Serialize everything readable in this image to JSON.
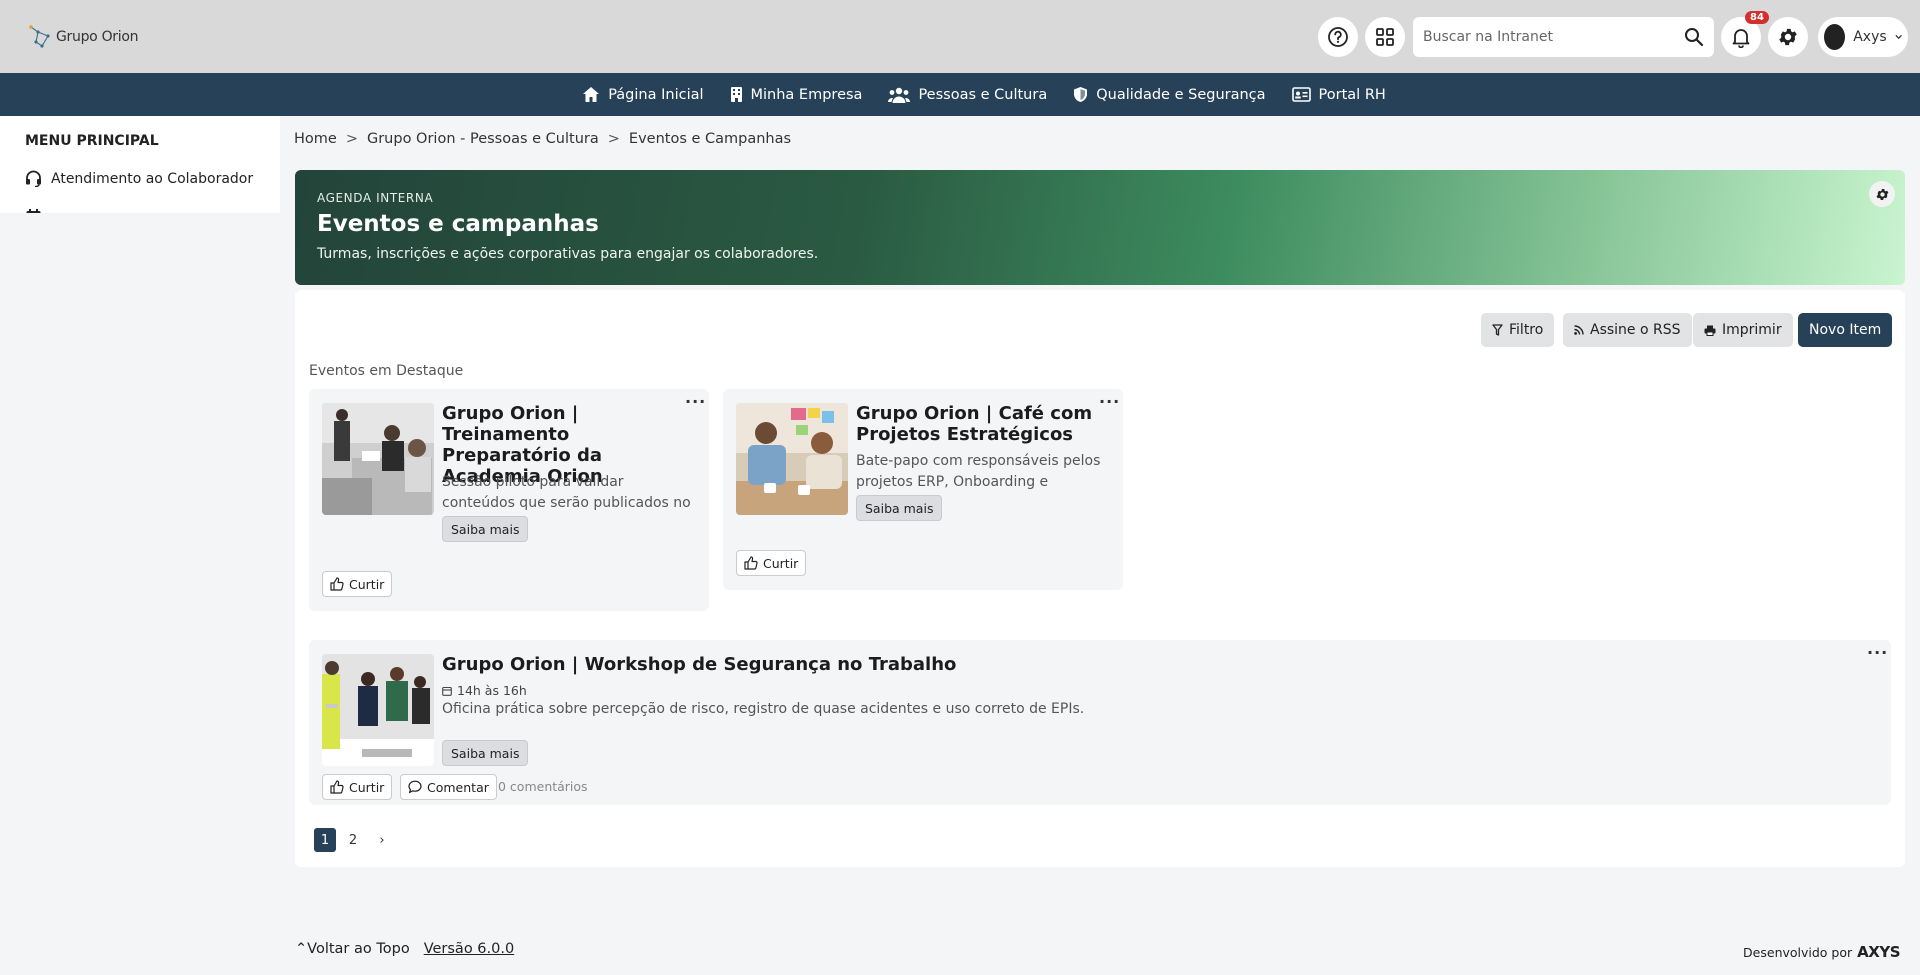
{
  "header": {
    "logo_text": "Grupo Orion",
    "search_placeholder": "Buscar na Intranet",
    "notifications_count": "84",
    "user_name": "Axys"
  },
  "nav": {
    "items": [
      {
        "label": "Página Inicial",
        "icon": "home-icon"
      },
      {
        "label": "Minha Empresa",
        "icon": "building-icon"
      },
      {
        "label": "Pessoas e Cultura",
        "icon": "people-icon"
      },
      {
        "label": "Qualidade e Segurança",
        "icon": "shield-icon"
      },
      {
        "label": "Portal RH",
        "icon": "id-card-icon"
      }
    ]
  },
  "sidebar": {
    "title": "MENU PRINCIPAL",
    "items": [
      {
        "label": "Atendimento ao Colaborador",
        "icon": "headset-icon"
      }
    ]
  },
  "breadcrumb": [
    "Home",
    "Grupo Orion - Pessoas e Cultura",
    "Eventos e Campanhas"
  ],
  "hero": {
    "kicker": "AGENDA INTERNA",
    "title": "Eventos e campanhas",
    "subtitle": "Turmas, inscrições e ações corporativas para engajar os colaboradores."
  },
  "toolbar": {
    "filter": "Filtro",
    "rss": "Assine o RSS",
    "print": "Imprimir",
    "new_item": "Novo Item"
  },
  "featured": {
    "label": "Eventos em Destaque",
    "cards": [
      {
        "title": "Grupo Orion | Treinamento Preparatório da Academia Orion",
        "description": "Sessão piloto para validar conteúdos que serão publicados no módulo de...",
        "more": "Saiba mais",
        "like": "Curtir"
      },
      {
        "title": "Grupo Orion | Café com Projetos Estratégicos",
        "description": "Bate-papo com responsáveis pelos projetos ERP, Onboarding e Qualida...",
        "more": "Saiba mais",
        "like": "Curtir"
      }
    ]
  },
  "list": [
    {
      "title": "Grupo Orion | Workshop de Segurança no Trabalho",
      "time": "14h às 16h",
      "description": "Oficina prática sobre percepção de risco, registro de quase acidentes e uso correto de EPIs.",
      "more": "Saiba mais",
      "like": "Curtir",
      "comment": "Comentar",
      "comments_count": "0 comentários"
    }
  ],
  "pagination": {
    "pages": [
      "1",
      "2"
    ],
    "next": "›",
    "current": "1"
  },
  "footer": {
    "back_to_top": "Voltar ao Topo",
    "version": "Versão 6.0.0",
    "developed_by": "Desenvolvido por",
    "brand": "AXYS"
  }
}
